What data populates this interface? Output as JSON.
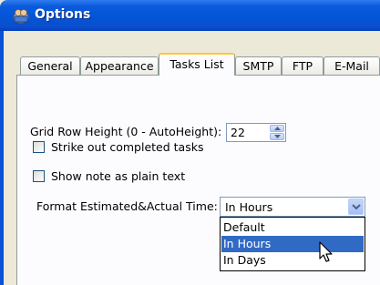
{
  "window": {
    "title": "Options"
  },
  "tabs": [
    {
      "label": "General",
      "active": false
    },
    {
      "label": "Appearance",
      "active": false
    },
    {
      "label": "Tasks List",
      "active": true
    },
    {
      "label": "SMTP",
      "active": false
    },
    {
      "label": "FTP",
      "active": false
    },
    {
      "label": "E-Mail",
      "active": false
    }
  ],
  "grid_row_height": {
    "label": "Grid Row Height (0 - AutoHeight):",
    "value": "22"
  },
  "checkboxes": [
    {
      "label": "Strike out completed tasks",
      "checked": false
    },
    {
      "label": "Show note as plain text",
      "checked": false
    }
  ],
  "format_time": {
    "label": "Format Estimated&Actual Time:",
    "selected": "In Hours",
    "options": [
      "Default",
      "In Hours",
      "In Days"
    ],
    "highlighted": "In Hours"
  },
  "colors": {
    "title_bar": "#0454d8",
    "selection": "#316ac5",
    "active_tab_accent": "#ffc83c"
  }
}
